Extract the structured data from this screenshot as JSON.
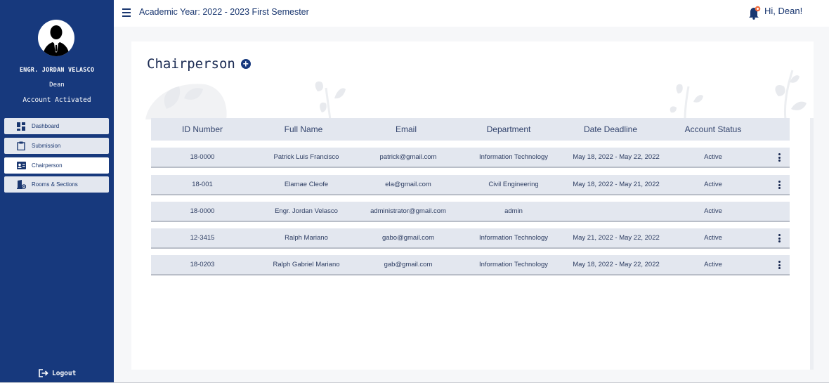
{
  "sidebar": {
    "user_name": "ENGR. JORDAN VELASCO",
    "user_role": "Dean",
    "account_status": "Account Activated",
    "nav": [
      {
        "label": "Dashboard",
        "icon": "dashboard-icon"
      },
      {
        "label": "Submission",
        "icon": "clipboard-icon"
      },
      {
        "label": "Chairperson",
        "icon": "contact-card-icon",
        "active": true
      },
      {
        "label": "Rooms & Sections",
        "icon": "room-settings-icon"
      }
    ],
    "logout_label": "Logout"
  },
  "topbar": {
    "academic_year": "Academic Year: 2022 - 2023 First Semester",
    "greeting": "Hi, Dean!"
  },
  "page": {
    "title": "Chairperson"
  },
  "table": {
    "headers": [
      "ID Number",
      "Full Name",
      "Email",
      "Department",
      "Date Deadline",
      "Account Status"
    ],
    "rows": [
      {
        "id": "18-0000",
        "name": "Patrick Luis Francisco",
        "email": "patrick@gmail.com",
        "department": "Information Technology",
        "deadline": "May 18, 2022 - May 22, 2022",
        "status": "Active",
        "has_menu": true
      },
      {
        "id": "18-001",
        "name": "Elamae Cleofe",
        "email": "ela@gmail.com",
        "department": "Civil Engineering",
        "deadline": "May 18, 2022 - May 21, 2022",
        "status": "Active",
        "has_menu": true
      },
      {
        "id": "18-0000",
        "name": "Engr. Jordan Velasco",
        "email": "administrator@gmail.com",
        "department": "admin",
        "deadline": "",
        "status": "Active",
        "has_menu": false
      },
      {
        "id": "12-3415",
        "name": "Ralph Mariano",
        "email": "gabo@gmail.com",
        "department": "Information Technology",
        "deadline": "May 21, 2022 - May 22, 2022",
        "status": "Active",
        "has_menu": true
      },
      {
        "id": "18-0203",
        "name": "Ralph Gabriel Mariano",
        "email": "gab@gmail.com",
        "department": "Information Technology",
        "deadline": "May 18, 2022 - May 22, 2022",
        "status": "Active",
        "has_menu": true
      }
    ]
  },
  "colors": {
    "sidebar": "#17397d",
    "accent": "#1a3770",
    "row_background": "#e3e7ef",
    "notification": "#f06a3a"
  }
}
